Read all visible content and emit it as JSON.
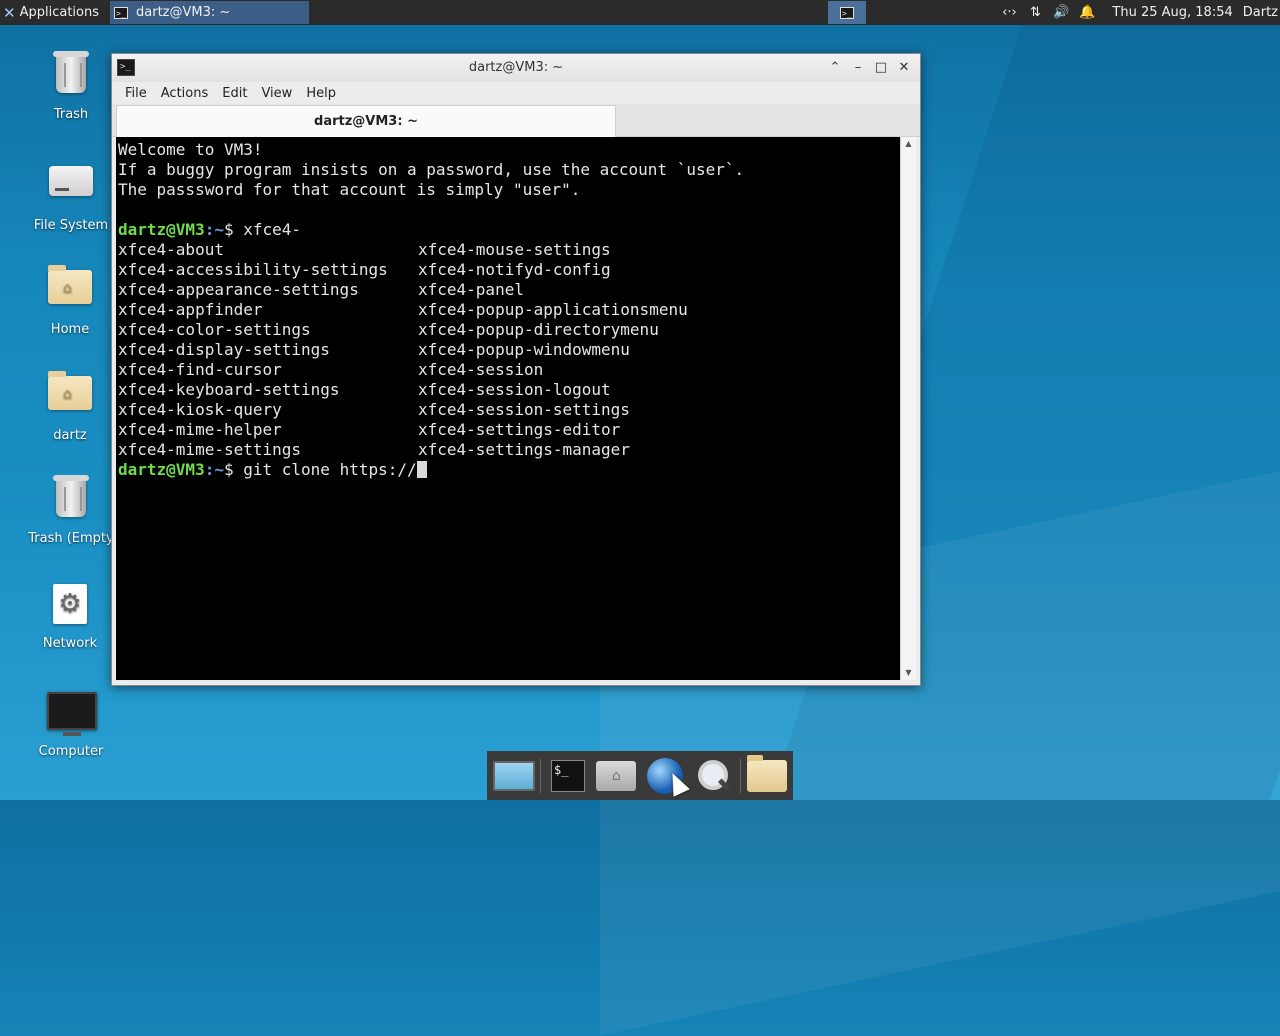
{
  "top_panel": {
    "applications_label": "Applications",
    "task_title": "dartz@VM3: ~",
    "clock": "Thu 25 Aug, 18:54",
    "user": "Dartz",
    "icons": [
      "network-icon",
      "transfer-icon",
      "volume-icon",
      "bell-icon"
    ]
  },
  "desktop_icons": [
    {
      "label": "Trash",
      "icon": "trash-icon"
    },
    {
      "label": "File System",
      "icon": "drive-icon"
    },
    {
      "label": "Home",
      "icon": "home-folder-icon"
    },
    {
      "label": "dartz",
      "icon": "home-folder-icon"
    },
    {
      "label": "Trash (Empty",
      "icon": "trash-icon"
    },
    {
      "label": "Network",
      "icon": "gear-icon"
    },
    {
      "label": "Computer",
      "icon": "monitor-icon"
    }
  ],
  "window": {
    "title": "dartz@VM3: ~",
    "menu": [
      "File",
      "Actions",
      "Edit",
      "View",
      "Help"
    ],
    "tab_label": "dartz@VM3: ~"
  },
  "terminal": {
    "welcome": [
      "Welcome to VM3!",
      "If a buggy program insists on a password, use the account `user`.",
      "The passsword for that account is simply \"user\"."
    ],
    "prompt_user": "dartz@VM3",
    "prompt_path": ":~",
    "prompt_symbol": "$ ",
    "command1": "xfce4-",
    "completions": [
      [
        "xfce4-about",
        "xfce4-mouse-settings"
      ],
      [
        "xfce4-accessibility-settings",
        "xfce4-notifyd-config"
      ],
      [
        "xfce4-appearance-settings",
        "xfce4-panel"
      ],
      [
        "xfce4-appfinder",
        "xfce4-popup-applicationsmenu"
      ],
      [
        "xfce4-color-settings",
        "xfce4-popup-directorymenu"
      ],
      [
        "xfce4-display-settings",
        "xfce4-popup-windowmenu"
      ],
      [
        "xfce4-find-cursor",
        "xfce4-session"
      ],
      [
        "xfce4-keyboard-settings",
        "xfce4-session-logout"
      ],
      [
        "xfce4-kiosk-query",
        "xfce4-session-settings"
      ],
      [
        "xfce4-mime-helper",
        "xfce4-settings-editor"
      ],
      [
        "xfce4-mime-settings",
        "xfce4-settings-manager"
      ]
    ],
    "command2": "git clone https://"
  },
  "dock": [
    "show-desktop-icon",
    "terminal-icon",
    "home-icon",
    "web-browser-icon",
    "app-finder-icon",
    "folder-icon"
  ]
}
